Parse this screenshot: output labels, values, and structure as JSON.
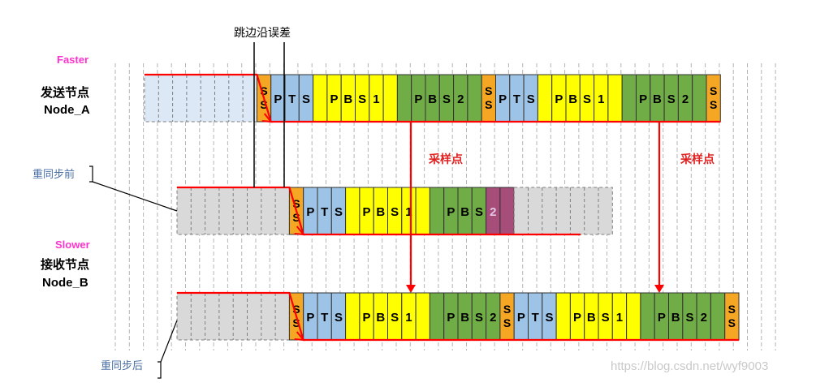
{
  "labels": {
    "top_annotation": "跳边沿误差",
    "faster": "Faster",
    "node_a_line1": "发送节点",
    "node_a_line2": "Node_A",
    "before_resync": "重同步前",
    "slower": "Slower",
    "node_b_line1": "接收节点",
    "node_b_line2": "Node_B",
    "after_resync": "重同步后",
    "sample_point_1": "采样点",
    "sample_point_2": "采样点",
    "watermark": "https://blog.csdn.net/wyf9003"
  },
  "colors": {
    "faster_label": "#ff33cc",
    "slower_label": "#ff33cc",
    "ss": "#f5a623",
    "pts": "#9dc3e6",
    "pbs1": "#ffff00",
    "pbs2": "#70ad47",
    "pbs2_late": "#a64d79",
    "idle_blue": "#dce8f5",
    "idle_gray": "#d9d9d9",
    "edge_line": "#ff0000"
  },
  "segments": [
    "SS",
    "PTS",
    "PBS1",
    "PBS2"
  ],
  "rows": [
    {
      "name": "node-a",
      "cells": [
        {
          "seg": "idle",
          "text": "",
          "q": 8
        },
        {
          "seg": "SS",
          "text": "S\nS",
          "q": 1
        },
        {
          "seg": "PTS",
          "text": "P",
          "q": 1
        },
        {
          "seg": "PTS",
          "text": "T",
          "q": 1
        },
        {
          "seg": "PTS",
          "text": "S",
          "q": 1
        },
        {
          "seg": "PBS1",
          "text": "",
          "q": 1
        },
        {
          "seg": "PBS1",
          "text": "P",
          "q": 1
        },
        {
          "seg": "PBS1",
          "text": "B",
          "q": 1
        },
        {
          "seg": "PBS1",
          "text": "S",
          "q": 1
        },
        {
          "seg": "PBS1",
          "text": "1",
          "q": 1
        },
        {
          "seg": "PBS1",
          "text": "",
          "q": 1
        },
        {
          "seg": "PBS2",
          "text": "",
          "q": 1
        },
        {
          "seg": "PBS2",
          "text": "P",
          "q": 1
        },
        {
          "seg": "PBS2",
          "text": "B",
          "q": 1
        },
        {
          "seg": "PBS2",
          "text": "S",
          "q": 1
        },
        {
          "seg": "PBS2",
          "text": "2",
          "q": 1
        },
        {
          "seg": "PBS2",
          "text": "",
          "q": 1
        },
        {
          "seg": "SS",
          "text": "S\nS",
          "q": 1
        },
        {
          "seg": "PTS",
          "text": "P",
          "q": 1
        },
        {
          "seg": "PTS",
          "text": "T",
          "q": 1
        },
        {
          "seg": "PTS",
          "text": "S",
          "q": 1
        },
        {
          "seg": "PBS1",
          "text": "",
          "q": 1
        },
        {
          "seg": "PBS1",
          "text": "P",
          "q": 1
        },
        {
          "seg": "PBS1",
          "text": "B",
          "q": 1
        },
        {
          "seg": "PBS1",
          "text": "S",
          "q": 1
        },
        {
          "seg": "PBS1",
          "text": "1",
          "q": 1
        },
        {
          "seg": "PBS1",
          "text": "",
          "q": 1
        },
        {
          "seg": "PBS2",
          "text": "",
          "q": 1
        },
        {
          "seg": "PBS2",
          "text": "P",
          "q": 1
        },
        {
          "seg": "PBS2",
          "text": "B",
          "q": 1
        },
        {
          "seg": "PBS2",
          "text": "S",
          "q": 1
        },
        {
          "seg": "PBS2",
          "text": "2",
          "q": 1
        },
        {
          "seg": "PBS2",
          "text": "",
          "q": 1
        },
        {
          "seg": "SS",
          "text": "S\nS",
          "q": 1
        }
      ]
    },
    {
      "name": "node-b-before",
      "cells": [
        {
          "seg": "idle",
          "text": "",
          "q": 8
        },
        {
          "seg": "SS",
          "text": "S\nS",
          "q": 1
        },
        {
          "seg": "PTS",
          "text": "P",
          "q": 1
        },
        {
          "seg": "PTS",
          "text": "T",
          "q": 1
        },
        {
          "seg": "PTS",
          "text": "S",
          "q": 1
        },
        {
          "seg": "PBS1",
          "text": "",
          "q": 1
        },
        {
          "seg": "PBS1",
          "text": "P",
          "q": 1
        },
        {
          "seg": "PBS1",
          "text": "B",
          "q": 1
        },
        {
          "seg": "PBS1",
          "text": "S",
          "q": 1
        },
        {
          "seg": "PBS1",
          "text": "1",
          "q": 1
        },
        {
          "seg": "PBS1",
          "text": "",
          "q": 1
        },
        {
          "seg": "PBS2",
          "text": "",
          "q": 1
        },
        {
          "seg": "PBS2",
          "text": "P",
          "q": 1
        },
        {
          "seg": "PBS2",
          "text": "B",
          "q": 1
        },
        {
          "seg": "PBS2",
          "text": "S",
          "q": 1
        },
        {
          "seg": "PBS2_LATE",
          "text": "2",
          "q": 1
        },
        {
          "seg": "PBS2_LATE",
          "text": "",
          "q": 1
        },
        {
          "seg": "idle",
          "text": "",
          "q": 7
        }
      ]
    },
    {
      "name": "node-b-after",
      "cells": [
        {
          "seg": "idle",
          "text": "",
          "q": 8
        },
        {
          "seg": "SS",
          "text": "S\nS",
          "q": 1
        },
        {
          "seg": "PTS",
          "text": "P",
          "q": 1
        },
        {
          "seg": "PTS",
          "text": "T",
          "q": 1
        },
        {
          "seg": "PTS",
          "text": "S",
          "q": 1
        },
        {
          "seg": "PBS1",
          "text": "",
          "q": 1
        },
        {
          "seg": "PBS1",
          "text": "P",
          "q": 1
        },
        {
          "seg": "PBS1",
          "text": "B",
          "q": 1
        },
        {
          "seg": "PBS1",
          "text": "S",
          "q": 1
        },
        {
          "seg": "PBS1",
          "text": "1",
          "q": 1
        },
        {
          "seg": "PBS1",
          "text": "",
          "q": 1
        },
        {
          "seg": "PBS2",
          "text": "",
          "q": 1
        },
        {
          "seg": "PBS2",
          "text": "P",
          "q": 1
        },
        {
          "seg": "PBS2",
          "text": "B",
          "q": 1
        },
        {
          "seg": "PBS2",
          "text": "S",
          "q": 1
        },
        {
          "seg": "PBS2",
          "text": "2",
          "q": 1
        },
        {
          "seg": "SS",
          "text": "S\nS",
          "q": 1
        },
        {
          "seg": "PTS",
          "text": "P",
          "q": 1
        },
        {
          "seg": "PTS",
          "text": "T",
          "q": 1
        },
        {
          "seg": "PTS",
          "text": "S",
          "q": 1
        },
        {
          "seg": "PBS1",
          "text": "",
          "q": 1
        },
        {
          "seg": "PBS1",
          "text": "P",
          "q": 1
        },
        {
          "seg": "PBS1",
          "text": "B",
          "q": 1
        },
        {
          "seg": "PBS1",
          "text": "S",
          "q": 1
        },
        {
          "seg": "PBS1",
          "text": "1",
          "q": 1
        },
        {
          "seg": "PBS1",
          "text": "",
          "q": 1
        },
        {
          "seg": "PBS2",
          "text": "",
          "q": 1
        },
        {
          "seg": "PBS2",
          "text": "P",
          "q": 1
        },
        {
          "seg": "PBS2",
          "text": "B",
          "q": 1
        },
        {
          "seg": "PBS2",
          "text": "S",
          "q": 1
        },
        {
          "seg": "PBS2",
          "text": "2",
          "q": 1
        },
        {
          "seg": "PBS2",
          "text": "",
          "q": 1
        },
        {
          "seg": "SS",
          "text": "S\nS",
          "q": 1
        }
      ]
    }
  ]
}
